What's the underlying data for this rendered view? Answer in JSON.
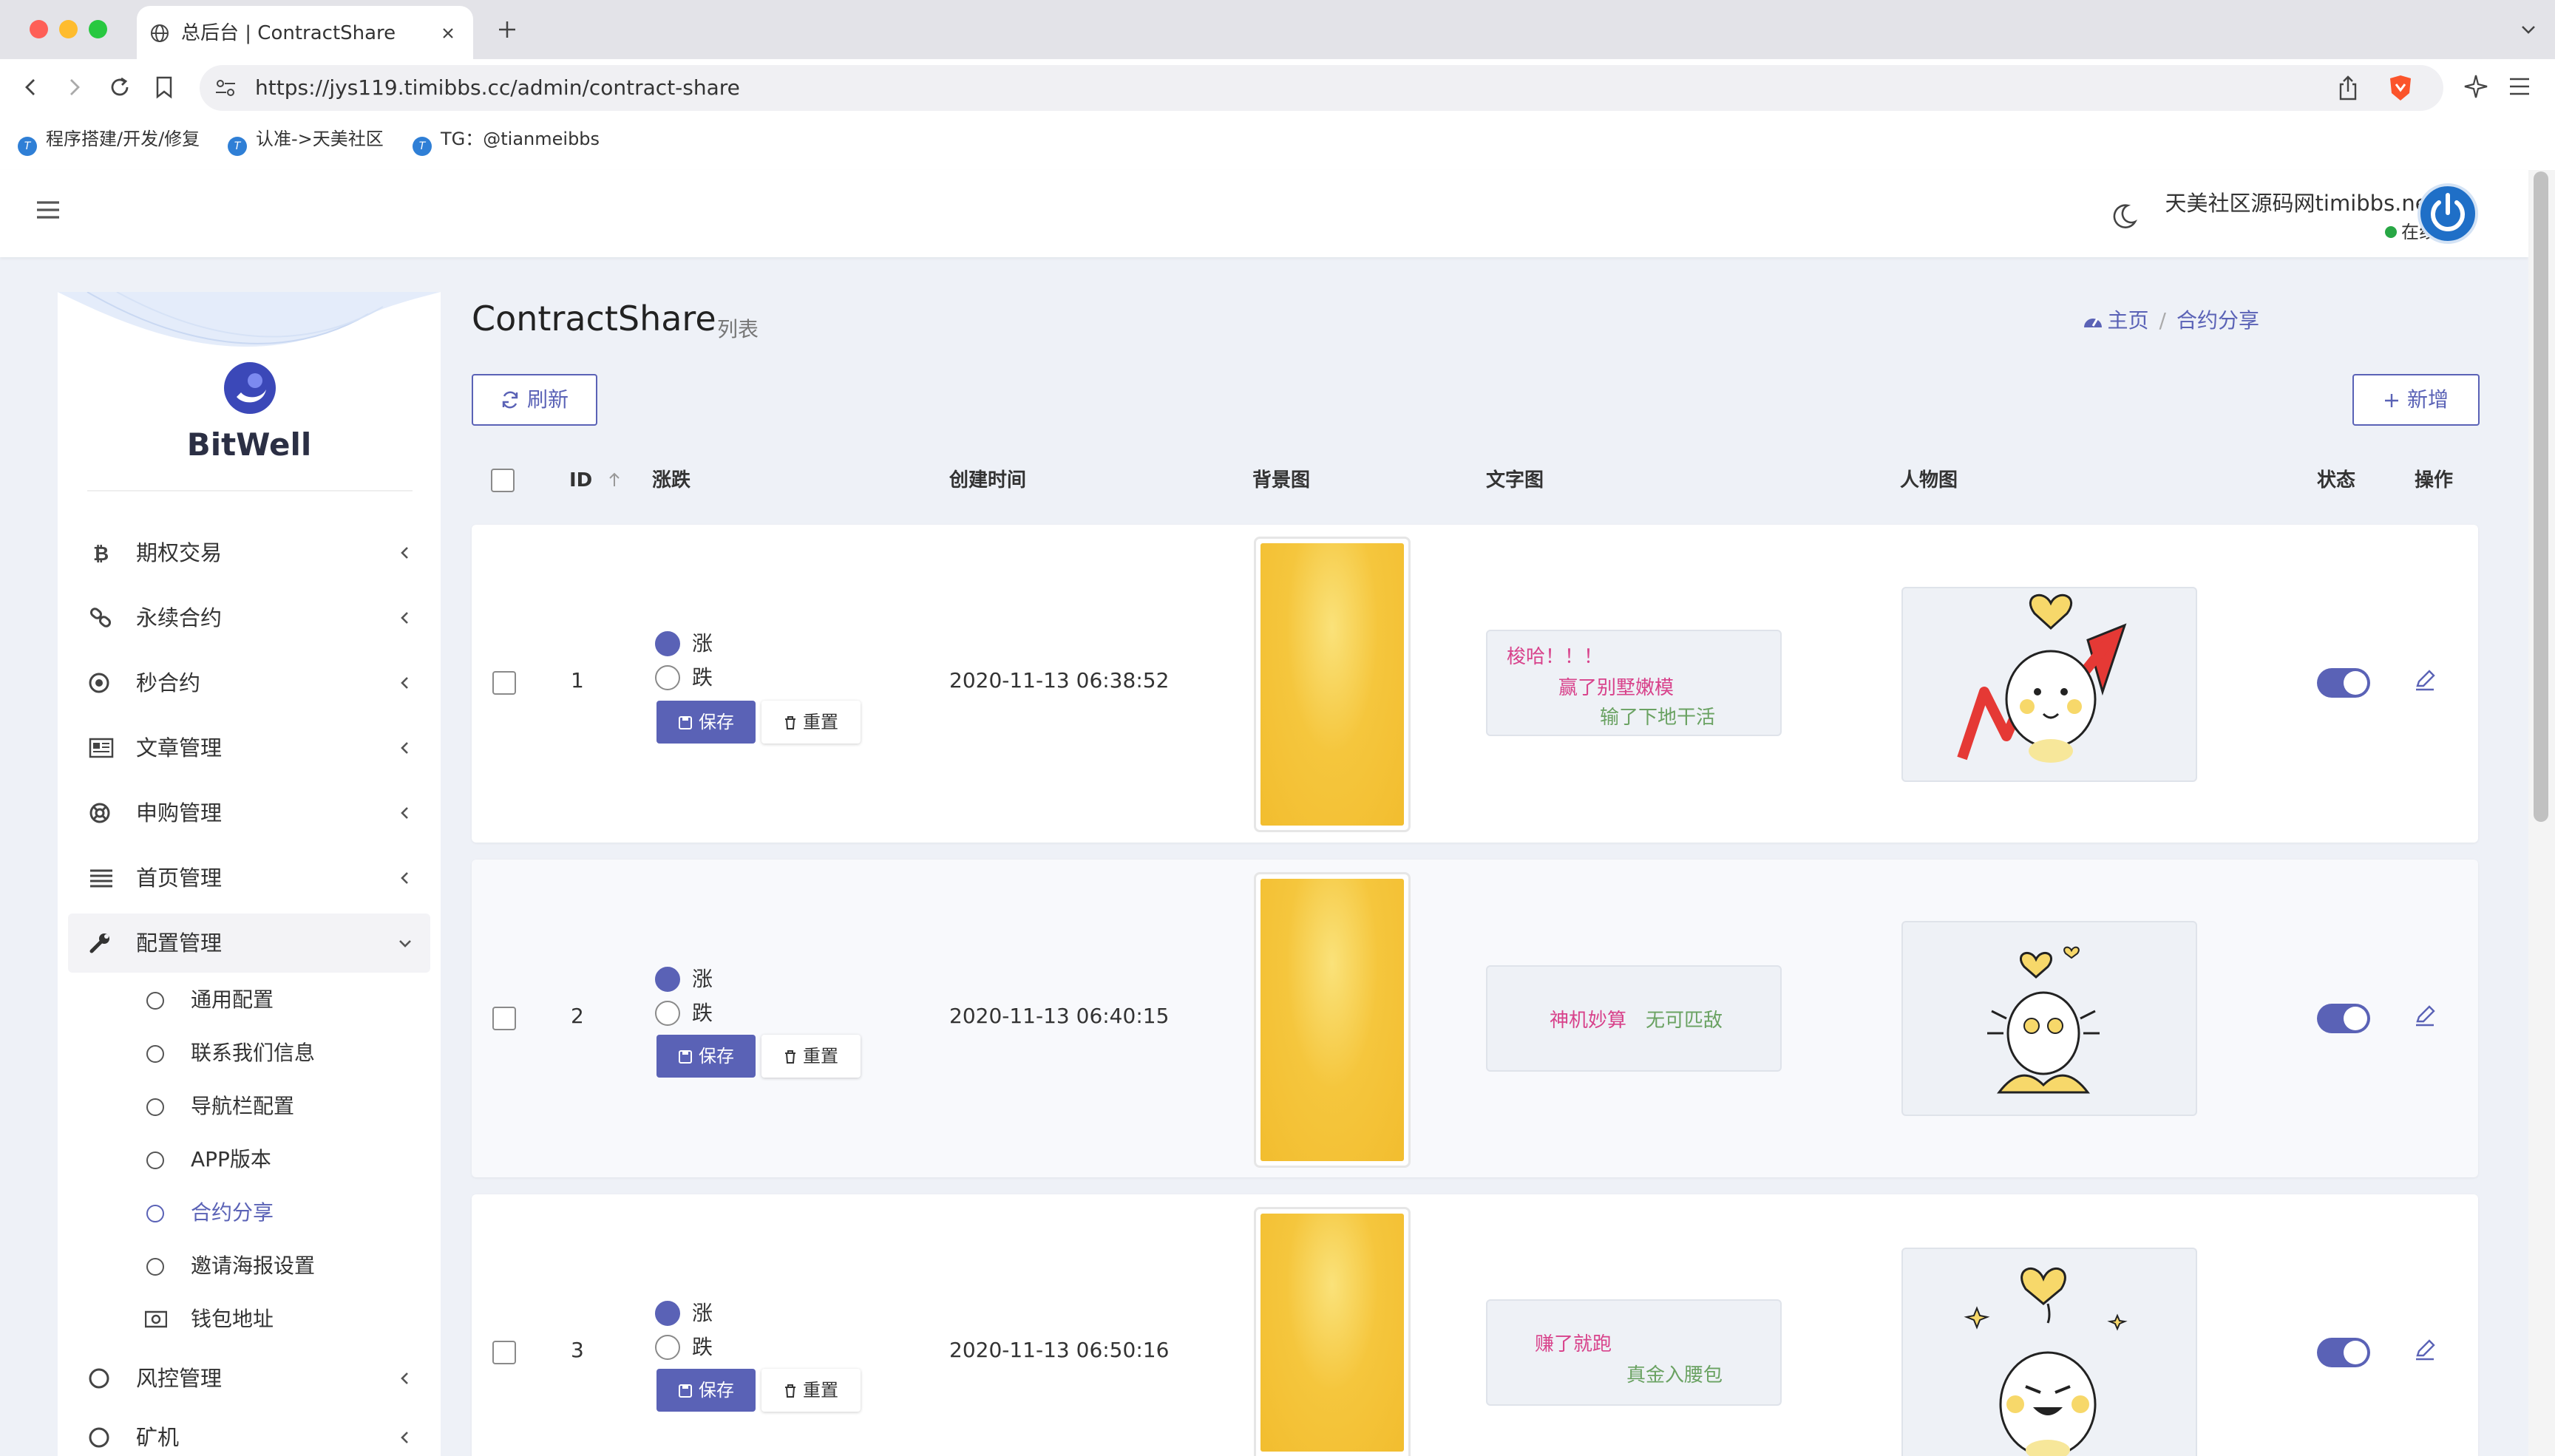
{
  "browser": {
    "tab_title": "总后台 | ContractShare",
    "url": "https://jys119.timibbs.cc/admin/contract-share",
    "bookmarks": [
      "程序搭建/开发/修复",
      "认准->天美社区",
      "TG：@tianmeibbs"
    ]
  },
  "header": {
    "user_name": "天美社区源码网timibbs.net",
    "user_status": "在线"
  },
  "sidebar": {
    "brand": "BitWell",
    "items": [
      {
        "label": "期权交易",
        "icon": "bitcoin-icon"
      },
      {
        "label": "永续合约",
        "icon": "link-icon"
      },
      {
        "label": "秒合约",
        "icon": "target-icon"
      },
      {
        "label": "文章管理",
        "icon": "newspaper-icon"
      },
      {
        "label": "申购管理",
        "icon": "lifebuoy-icon"
      },
      {
        "label": "首页管理",
        "icon": "list-icon"
      },
      {
        "label": "配置管理",
        "icon": "wrench-icon"
      }
    ],
    "sub_items": [
      "通用配置",
      "联系我们信息",
      "导航栏配置",
      "APP版本",
      "合约分享",
      "邀请海报设置",
      "钱包地址"
    ],
    "after_items": [
      {
        "label": "风控管理",
        "icon": "circle-icon"
      },
      {
        "label": "矿机",
        "icon": "circle-icon"
      }
    ]
  },
  "page": {
    "title": "ContractShare",
    "subtitle": "列表",
    "breadcrumb": [
      "主页",
      "合约分享"
    ],
    "refresh_label": "刷新",
    "new_label": "新增"
  },
  "table": {
    "columns": [
      "ID",
      "涨跌",
      "创建时间",
      "背景图",
      "文字图",
      "人物图",
      "状态",
      "操作"
    ],
    "rise_label": "涨",
    "fall_label": "跌",
    "save_label": "保存",
    "reset_label": "重置",
    "rows": [
      {
        "id": "1",
        "selected": "涨",
        "created": "2020-11-13 06:38:52",
        "text_lines": [
          "梭哈！！！",
          "赢了别墅嫩模",
          "输了下地干活"
        ],
        "status": true
      },
      {
        "id": "2",
        "selected": "涨",
        "created": "2020-11-13 06:40:15",
        "text_lines": [
          "神机妙算",
          "无可匹敌"
        ],
        "status": true
      },
      {
        "id": "3",
        "selected": "涨",
        "created": "2020-11-13 06:50:16",
        "text_lines": [
          "赚了就跑",
          "真金入腰包"
        ],
        "status": true
      }
    ]
  },
  "colors": {
    "accent": "#5a62b6",
    "content_bg": "#eef1f7",
    "pink_text": "#d8428b",
    "green_text": "#6aa262",
    "thumb_yellow": "#f5c63d"
  }
}
